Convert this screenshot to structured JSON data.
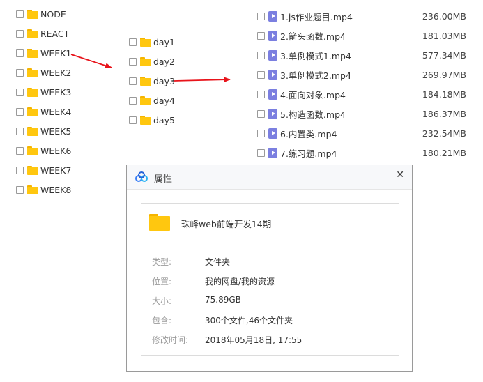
{
  "col1": {
    "items": [
      "NODE",
      "REACT",
      "WEEK1",
      "WEEK2",
      "WEEK3",
      "WEEK4",
      "WEEK5",
      "WEEK6",
      "WEEK7",
      "WEEK8"
    ]
  },
  "col2": {
    "items": [
      "day1",
      "day2",
      "day3",
      "day4",
      "day5"
    ]
  },
  "col3": {
    "files": [
      {
        "name": "1.js作业题目.mp4",
        "size": "236.00MB"
      },
      {
        "name": "2.箭头函数.mp4",
        "size": "181.03MB"
      },
      {
        "name": "3.单例模式1.mp4",
        "size": "577.34MB"
      },
      {
        "name": "3.单例模式2.mp4",
        "size": "269.97MB"
      },
      {
        "name": "4.面向对象.mp4",
        "size": "184.18MB"
      },
      {
        "name": "5.构造函数.mp4",
        "size": "186.37MB"
      },
      {
        "name": "6.内置类.mp4",
        "size": "232.54MB"
      },
      {
        "name": "7.练习题.mp4",
        "size": "180.21MB"
      }
    ]
  },
  "dialog": {
    "title": "属性",
    "close_glyph": "✕",
    "folder_name": "珠峰web前端开发14期",
    "props": [
      {
        "label": "类型:",
        "value": "文件夹"
      },
      {
        "label": "位置:",
        "value": "我的网盘/我的资源"
      },
      {
        "label": "大小:",
        "value": "75.89GB"
      },
      {
        "label": "包含:",
        "value": "300个文件,46个文件夹"
      },
      {
        "label": "修改时间:",
        "value": "2018年05月18日, 17:55"
      }
    ]
  },
  "colors": {
    "arrow": "#e8141b",
    "folder": "#ffc70f",
    "video_icon": "#7b7fe0",
    "cloud_icon": "#3a7ff6"
  }
}
